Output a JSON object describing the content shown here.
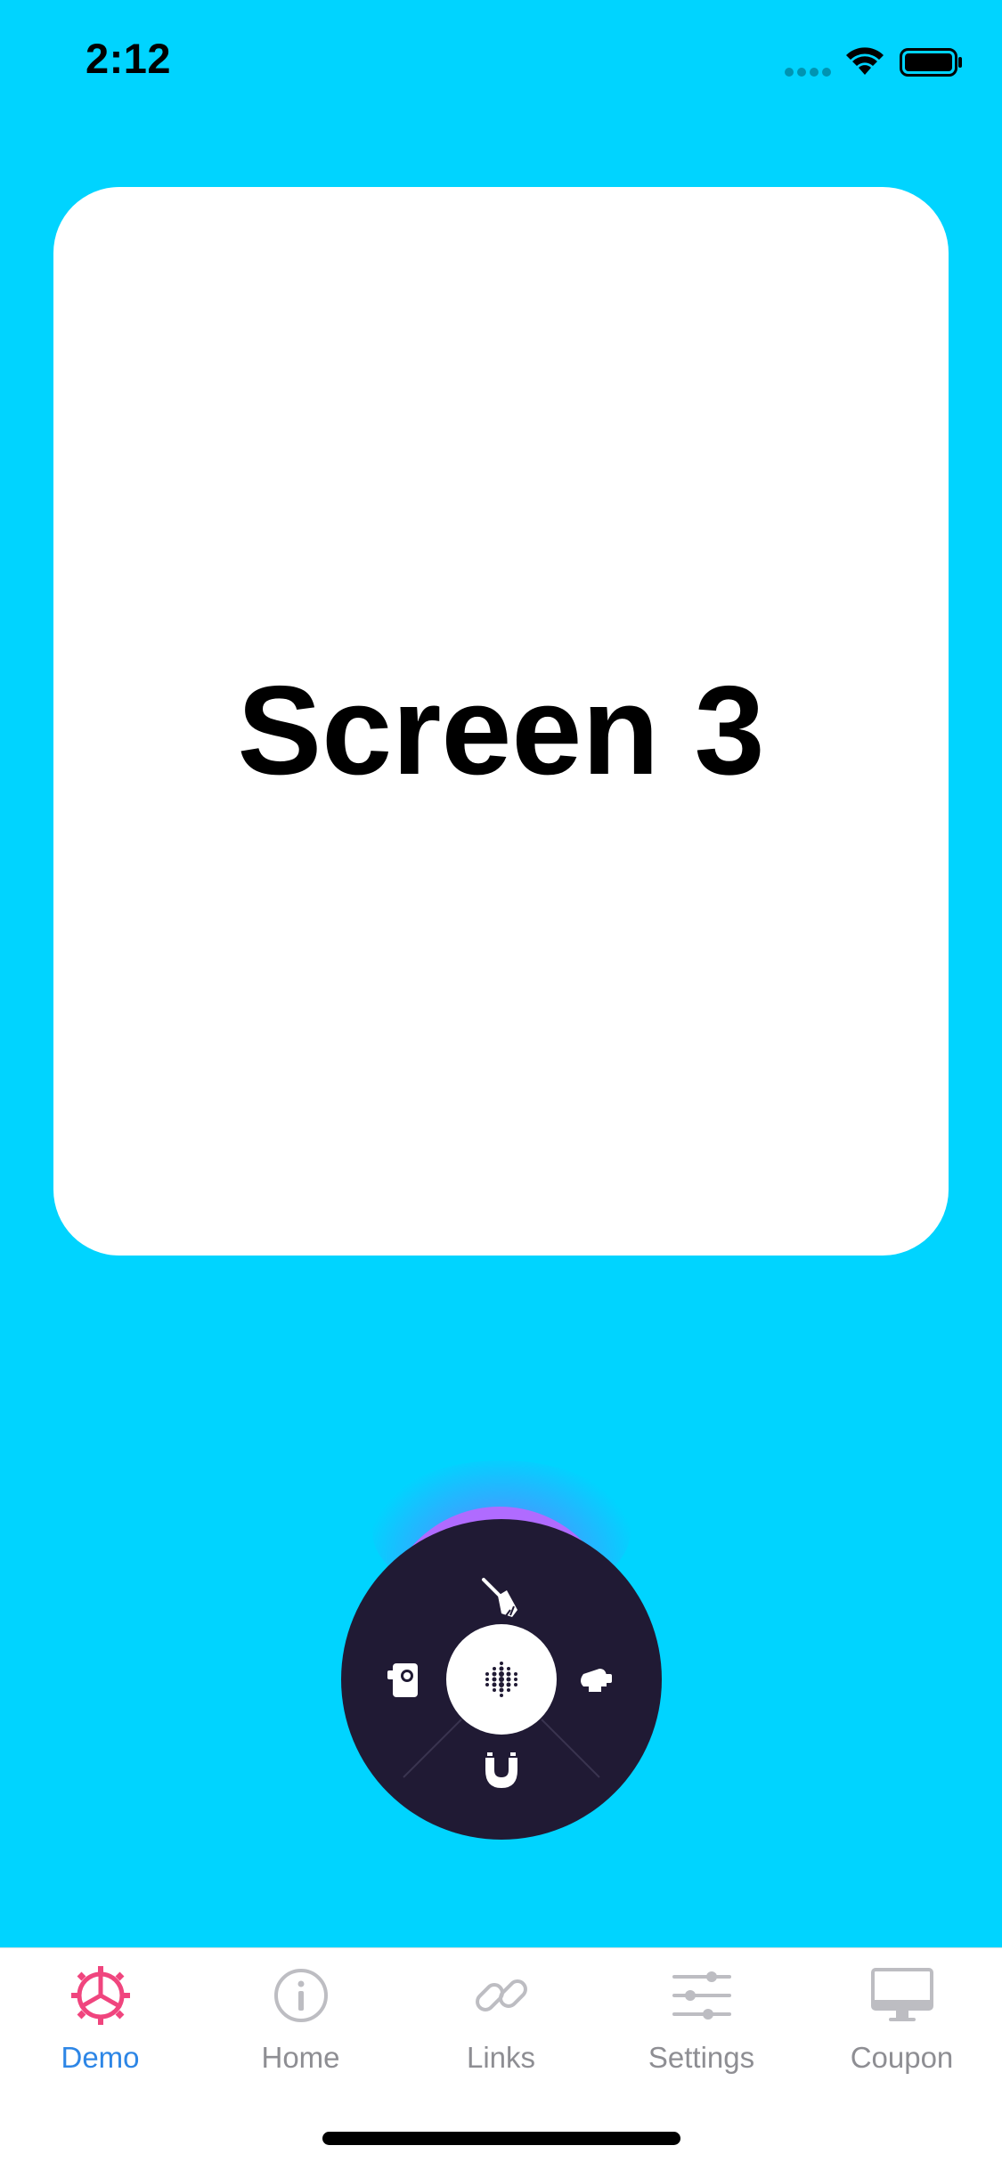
{
  "status_bar": {
    "time": "2:12"
  },
  "card": {
    "title": "Screen 3",
    "background": "#FFFFFF"
  },
  "background_color": "#00D4FF",
  "radial_menu": {
    "background": "#201A34",
    "accent": "#B06BFF",
    "items": [
      {
        "icon": "broom-icon",
        "position": "top"
      },
      {
        "icon": "camera-icon",
        "position": "left"
      },
      {
        "icon": "bell-icon",
        "position": "right"
      },
      {
        "icon": "magnet-icon",
        "position": "bottom"
      }
    ],
    "center_icon": "dots-grid-icon"
  },
  "tab_bar": {
    "active_color": "#2D86E6",
    "inactive_color": "#8E8E93",
    "accent_icon_color": "#F0457E",
    "tabs": [
      {
        "label": "Demo",
        "icon": "gear-icon",
        "active": true
      },
      {
        "label": "Home",
        "icon": "info-icon",
        "active": false
      },
      {
        "label": "Links",
        "icon": "link-icon",
        "active": false
      },
      {
        "label": "Settings",
        "icon": "sliders-icon",
        "active": false
      },
      {
        "label": "Coupon",
        "icon": "monitor-icon",
        "active": false
      }
    ]
  }
}
